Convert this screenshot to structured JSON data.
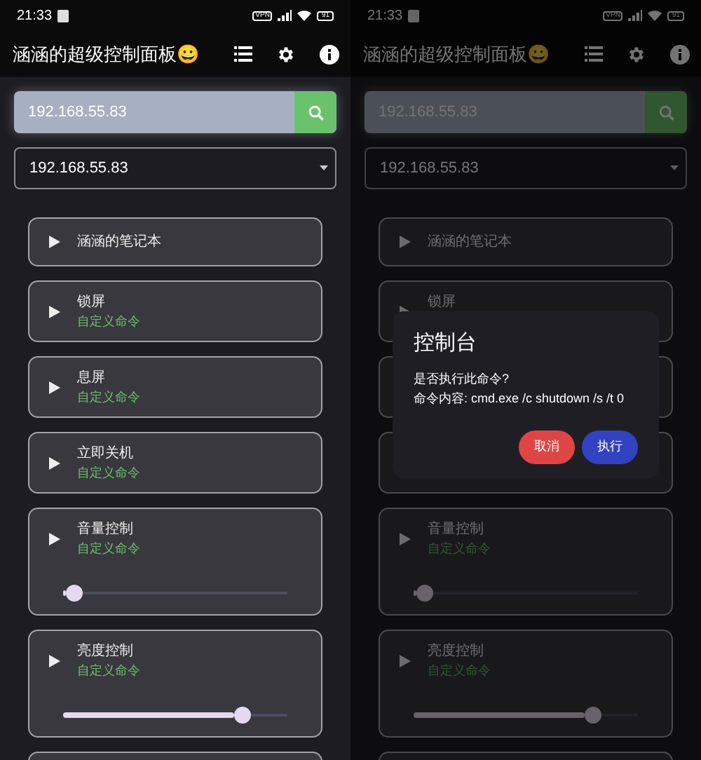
{
  "screens": [
    {
      "status_bar": {
        "time": "21:33",
        "vpn": "VPN",
        "battery": "91"
      },
      "app_title": "涵涵的超级控制面板😀",
      "ip_field": {
        "value": "192.168.55.83"
      },
      "ip_dropdown": {
        "value": "192.168.55.83"
      },
      "items": [
        {
          "kind": "plain",
          "title": "涵涵的笔记本"
        },
        {
          "kind": "command",
          "title": "锁屏",
          "subtitle": "自定义命令"
        },
        {
          "kind": "command",
          "title": "息屏",
          "subtitle": "自定义命令"
        },
        {
          "kind": "command",
          "title": "立即关机",
          "subtitle": "自定义命令"
        },
        {
          "kind": "slider",
          "title": "音量控制",
          "subtitle": "自定义命令",
          "level": 0.05
        },
        {
          "kind": "slider",
          "title": "亮度控制",
          "subtitle": "自定义命令",
          "level": 0.8
        },
        {
          "kind": "partial"
        }
      ]
    },
    {
      "status_bar": {
        "time": "21:33",
        "vpn": "VPN",
        "battery": "91"
      },
      "app_title": "涵涵的超级控制面板😀",
      "ip_field": {
        "value": "192.168.55.83"
      },
      "ip_dropdown": {
        "value": "192.168.55.83"
      },
      "items": [
        {
          "kind": "plain",
          "title": "涵涵的笔记本"
        },
        {
          "kind": "command",
          "title": "锁屏"
        },
        {
          "kind": "covered"
        },
        {
          "kind": "covered"
        },
        {
          "kind": "slider",
          "title": "音量控制",
          "subtitle": "自定义命令",
          "level": 0.05
        },
        {
          "kind": "slider",
          "title": "亮度控制",
          "subtitle": "自定义命令",
          "level": 0.8
        },
        {
          "kind": "partial"
        }
      ],
      "dialog": {
        "title": "控制台",
        "message": "是否执行此命令?",
        "command": "命令内容: cmd.exe /c shutdown /s /t 0",
        "buttons": [
          {
            "kind": "cancel",
            "label": "取消"
          },
          {
            "kind": "confirm",
            "label": "执行"
          }
        ]
      }
    }
  ]
}
